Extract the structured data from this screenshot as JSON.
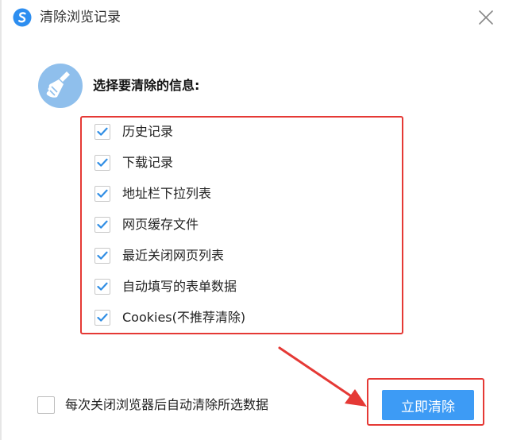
{
  "window": {
    "title": "清除浏览记录",
    "logo_icon": "sogou-browser-logo-icon",
    "close_icon": "close-icon"
  },
  "section": {
    "icon": "broom-icon",
    "title": "选择要清除的信息:"
  },
  "options": [
    {
      "label": "历史记录",
      "checked": true
    },
    {
      "label": "下载记录",
      "checked": true
    },
    {
      "label": "地址栏下拉列表",
      "checked": true
    },
    {
      "label": "网页缓存文件",
      "checked": true
    },
    {
      "label": "最近关闭网页列表",
      "checked": true
    },
    {
      "label": "自动填写的表单数据",
      "checked": true
    },
    {
      "label": "Cookies(不推荐清除)",
      "checked": true
    }
  ],
  "footer": {
    "auto_clear_label": "每次关闭浏览器后自动清除所选数据",
    "auto_clear_checked": false,
    "clear_button_label": "立即清除"
  },
  "colors": {
    "accent": "#3d9bf5",
    "highlight": "#e53935",
    "checkmark": "#2f8de4"
  }
}
